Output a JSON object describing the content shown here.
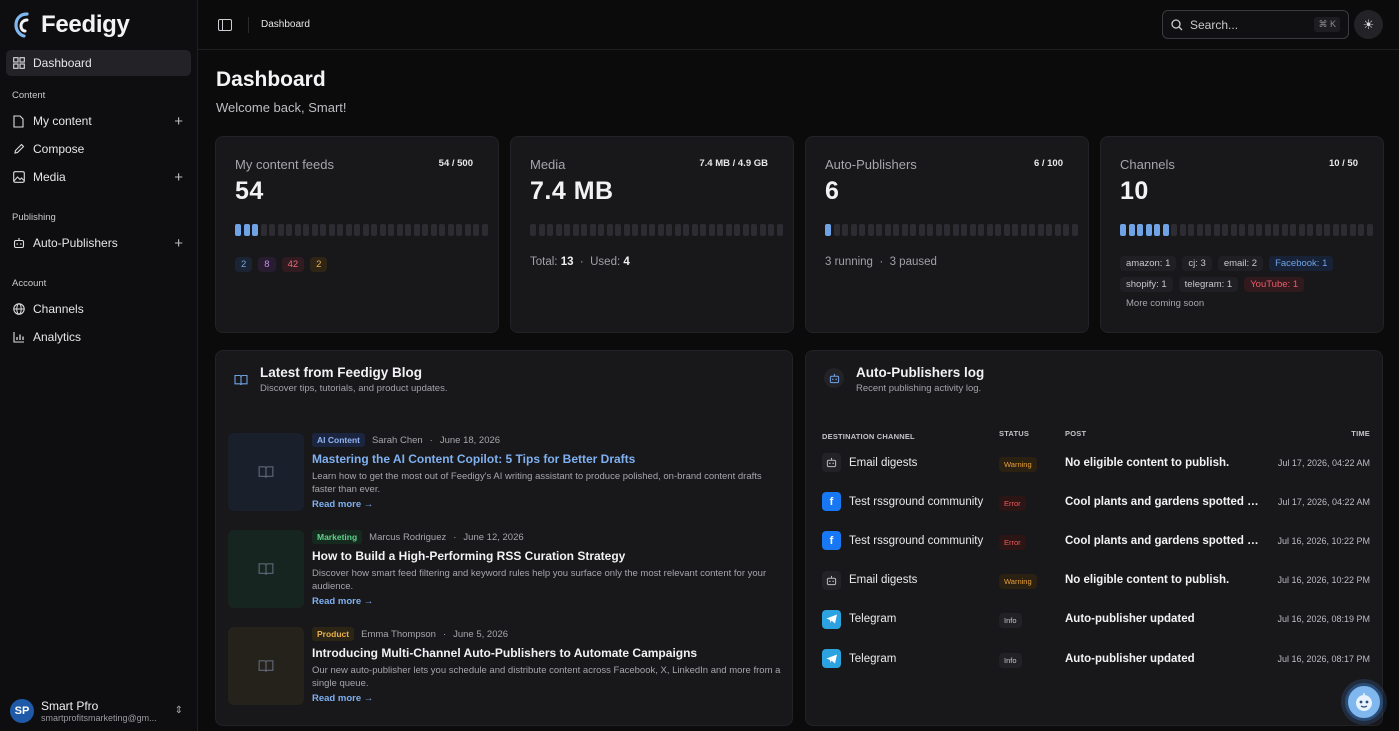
{
  "app": {
    "name": "Feedigy"
  },
  "sidebar": {
    "items": [
      {
        "label": "Dashboard"
      }
    ],
    "sections": [
      {
        "label": "Content",
        "items": [
          {
            "label": "My content"
          },
          {
            "label": "Compose"
          },
          {
            "label": "Media"
          }
        ]
      },
      {
        "label": "Publishing",
        "items": [
          {
            "label": "Auto-Publishers"
          }
        ]
      },
      {
        "label": "Account",
        "items": [
          {
            "label": "Channels"
          },
          {
            "label": "Analytics"
          }
        ]
      }
    ],
    "user": {
      "initials": "SP",
      "name": "Smart Pfro",
      "email": "smartprofitsmarketing@gm..."
    }
  },
  "topbar": {
    "breadcrumb": "Dashboard",
    "search_placeholder": "Search...",
    "shortcut": "⌘ K"
  },
  "header": {
    "title": "Dashboard",
    "subtitle": "Welcome back, Smart!"
  },
  "stats": {
    "feeds": {
      "title": "My content feeds",
      "ratio": "54 / 500",
      "value": "54",
      "filled": 3,
      "chips": [
        {
          "label": "2",
          "color": "#6fa3e6",
          "bg": "#1b2433"
        },
        {
          "label": "8",
          "color": "#c58be8",
          "bg": "#281c30"
        },
        {
          "label": "42",
          "color": "#ee6a7a",
          "bg": "#301b20"
        },
        {
          "label": "2",
          "color": "#e8b04a",
          "bg": "#2e2517"
        }
      ]
    },
    "media": {
      "title": "Media",
      "ratio": "7.4 MB / 4.9 GB",
      "value": "7.4 MB",
      "filled": 0,
      "total_label": "Total:",
      "total": "13",
      "used_label": "Used:",
      "used": "4"
    },
    "publishers": {
      "title": "Auto-Publishers",
      "ratio": "6 / 100",
      "value": "6",
      "filled": 1,
      "running": "3 running",
      "paused": "3 paused"
    },
    "channels": {
      "title": "Channels",
      "ratio": "10 / 50",
      "value": "10",
      "filled": 6,
      "rows": [
        [
          {
            "label": "amazon: 1",
            "color": "#c9c9cd",
            "bg": "#202024"
          },
          {
            "label": "cj: 3",
            "color": "#c9c9cd",
            "bg": "#202024"
          },
          {
            "label": "email: 2",
            "color": "#c9c9cd",
            "bg": "#202024"
          },
          {
            "label": "Facebook: 1",
            "color": "#6fa3e6",
            "bg": "#182236"
          }
        ],
        [
          {
            "label": "shopify: 1",
            "color": "#c9c9cd",
            "bg": "#202024"
          },
          {
            "label": "telegram: 1",
            "color": "#c9c9cd",
            "bg": "#202024"
          },
          {
            "label": "YouTube: 1",
            "color": "#ee5a6a",
            "bg": "#301a1e"
          }
        ]
      ],
      "more": "More coming soon"
    }
  },
  "blog": {
    "title": "Latest from Feedigy Blog",
    "subtitle": "Discover tips, tutorials, and product updates.",
    "posts": [
      {
        "tag": "AI Content",
        "tag_color": "#8fb4f2",
        "tag_bg": "#1c2540",
        "author": "Sarah Chen",
        "date": "June 18, 2026",
        "title": "Mastering the AI Content Copilot: 5 Tips for Better Drafts",
        "title_color": "#7fb0f0",
        "desc": "Learn how to get the most out of Feedigy's AI writing assistant to produce polished, on-brand content drafts faster than ever.",
        "link": "Read more →",
        "thumb_bg": "#1a1f2c"
      },
      {
        "tag": "Marketing",
        "tag_color": "#5fd18a",
        "tag_bg": "#16291f",
        "author": "Marcus Rodriguez",
        "date": "June 12, 2026",
        "title": "How to Build a High-Performing RSS Curation Strategy",
        "title_color": "#f2f2f4",
        "desc": "Discover how smart feed filtering and keyword rules help you surface only the most relevant content for your audience.",
        "link": "Read more →",
        "thumb_bg": "#172520"
      },
      {
        "tag": "Product",
        "tag_color": "#e8b04a",
        "tag_bg": "#2c2515",
        "author": "Emma Thompson",
        "date": "June 5, 2026",
        "title": "Introducing Multi-Channel Auto-Publishers to Automate Campaigns",
        "title_color": "#f2f2f4",
        "desc": "Our new auto-publisher lets you schedule and distribute content across Facebook, X, LinkedIn and more from a single queue.",
        "link": "Read more →",
        "thumb_bg": "#24221b"
      }
    ]
  },
  "log": {
    "title": "Auto-Publishers log",
    "subtitle": "Recent publishing activity log.",
    "columns": [
      "DESTINATION CHANNEL",
      "STATUS",
      "POST",
      "TIME"
    ],
    "rows": [
      {
        "channel": "Email digests",
        "icon": "email",
        "status": "Warning",
        "post": "No eligible content to publish.",
        "time": "Jul 17, 2026, 04:22 AM"
      },
      {
        "channel": "Test rssground community",
        "icon": "facebook",
        "status": "Error",
        "post": "Cool plants and gardens spotted in a ...",
        "time": "Jul 17, 2026, 04:22 AM"
      },
      {
        "channel": "Test rssground community",
        "icon": "facebook",
        "status": "Error",
        "post": "Cool plants and gardens spotted in a ...",
        "time": "Jul 16, 2026, 10:22 PM"
      },
      {
        "channel": "Email digests",
        "icon": "email",
        "status": "Warning",
        "post": "No eligible content to publish.",
        "time": "Jul 16, 2026, 10:22 PM"
      },
      {
        "channel": "Telegram",
        "icon": "telegram",
        "status": "Info",
        "post": "Auto-publisher updated",
        "time": "Jul 16, 2026, 08:19 PM"
      },
      {
        "channel": "Telegram",
        "icon": "telegram",
        "status": "Info",
        "post": "Auto-publisher updated",
        "time": "Jul 16, 2026, 08:17 PM"
      }
    ]
  },
  "colors": {
    "accent": "#6fa3e6",
    "warning": "#e8a03a",
    "error": "#ee5a5a",
    "info": "#c8c8cc"
  }
}
